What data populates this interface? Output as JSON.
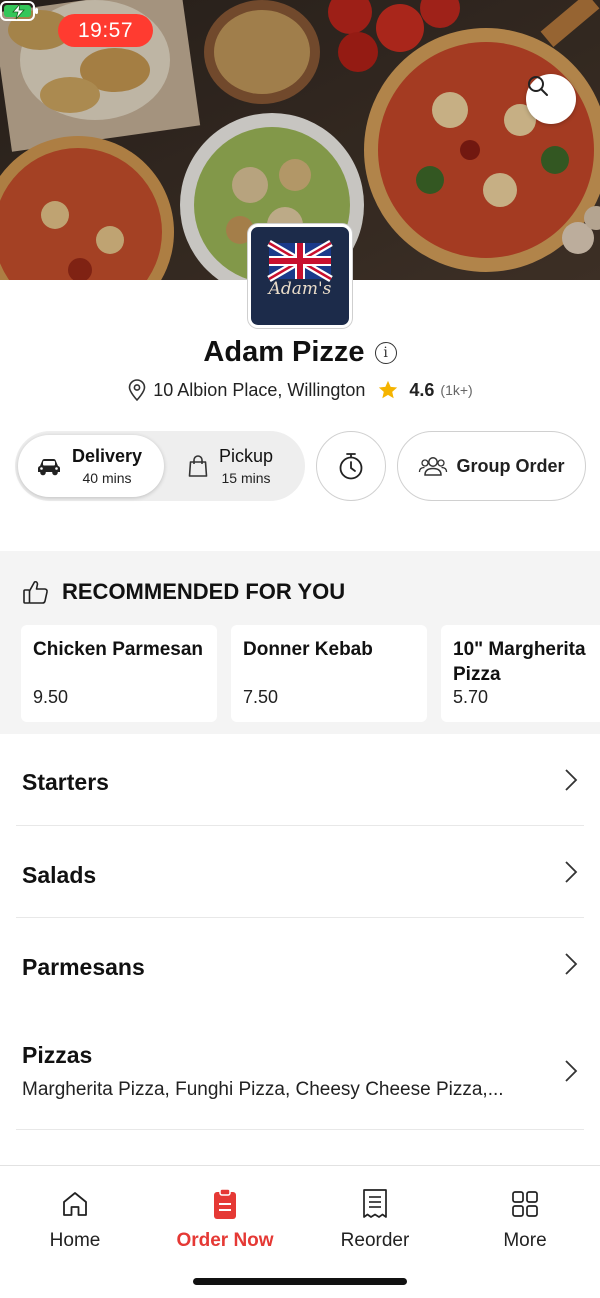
{
  "status_bar": {
    "time": "19:57",
    "accent": "#ff3b30"
  },
  "restaurant": {
    "name": "Adam Pizze",
    "logo_text": "Adam's",
    "address": "10 Albion Place, Willington",
    "rating": "4.6",
    "rating_count": "(1k+)"
  },
  "order_modes": {
    "delivery": {
      "label": "Delivery",
      "time": "40 mins",
      "selected": true
    },
    "pickup": {
      "label": "Pickup",
      "time": "15 mins",
      "selected": false
    }
  },
  "group_order": {
    "label": "Group Order"
  },
  "recommended": {
    "heading": "RECOMMENDED FOR YOU",
    "items": [
      {
        "name": "Chicken Parmesan",
        "price": "9.50"
      },
      {
        "name": "Donner Kebab",
        "price": "7.50"
      },
      {
        "name": "10\" Margherita Pizza",
        "price": "5.70"
      }
    ]
  },
  "categories": [
    {
      "title": "Starters",
      "subtitle": ""
    },
    {
      "title": "Salads",
      "subtitle": ""
    },
    {
      "title": "Parmesans",
      "subtitle": ""
    },
    {
      "title": "Pizzas",
      "subtitle": "Margherita Pizza, Funghi Pizza, Cheesy Cheese Pizza,..."
    }
  ],
  "tab_bar": {
    "active_color": "#e53935",
    "tabs": [
      {
        "label": "Home",
        "icon": "home-icon"
      },
      {
        "label": "Order Now",
        "icon": "order-icon",
        "active": true
      },
      {
        "label": "Reorder",
        "icon": "receipt-icon"
      },
      {
        "label": "More",
        "icon": "grid-icon"
      }
    ]
  },
  "icons": {
    "search": "search-icon",
    "info": "info-icon",
    "location": "location-pin-icon",
    "star": "star-icon",
    "car": "car-icon",
    "bag": "bag-icon",
    "timer": "timer-icon",
    "group": "group-icon",
    "thumbs_up": "thumbs-up-icon",
    "chevron": "chevron-right-icon"
  }
}
